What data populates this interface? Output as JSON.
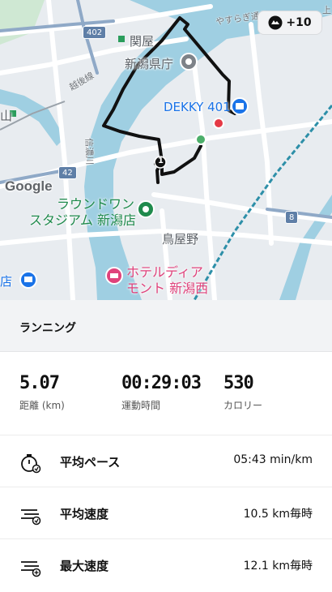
{
  "map": {
    "labels": {
      "sekiya": "関屋",
      "prefecture_office": "新潟県庁",
      "echigo_line": "越後線",
      "dekky": "DEKKY 401",
      "round1_line1": "ラウンドワン",
      "round1_line2": "スタジアム 新潟店",
      "toriyano": "鳥屋野",
      "hotel_line1": "ホテルディア",
      "hotel_line2": "モント 新潟西",
      "yasuragi": "やすらぎ通り",
      "upper": "上",
      "yama": "山",
      "shop_left": "店",
      "river": "信濃川",
      "google": "Google"
    },
    "shields": {
      "r402": "402",
      "r42": "42",
      "r8": "8",
      "km1": "1"
    },
    "badge_text": "+10",
    "colors": {
      "water": "#9fcfe2",
      "route": "#111111",
      "start_marker": "#4caf6a",
      "end_marker": "#e53945",
      "rail": "#2d8fa8"
    }
  },
  "activity": {
    "title": "ランニング"
  },
  "stats": {
    "distance_value": "5.07",
    "distance_label": "距離 (km)",
    "time_value": "00:29:03",
    "time_label": "運動時間",
    "calories_value": "530",
    "calories_label": "カロリー"
  },
  "metrics": {
    "pace_label": "平均ペース",
    "pace_value": "05:43 min/km",
    "avg_speed_label": "平均速度",
    "avg_speed_value": "10.5 km毎時",
    "max_speed_label": "最大速度",
    "max_speed_value": "12.1 km毎時"
  }
}
